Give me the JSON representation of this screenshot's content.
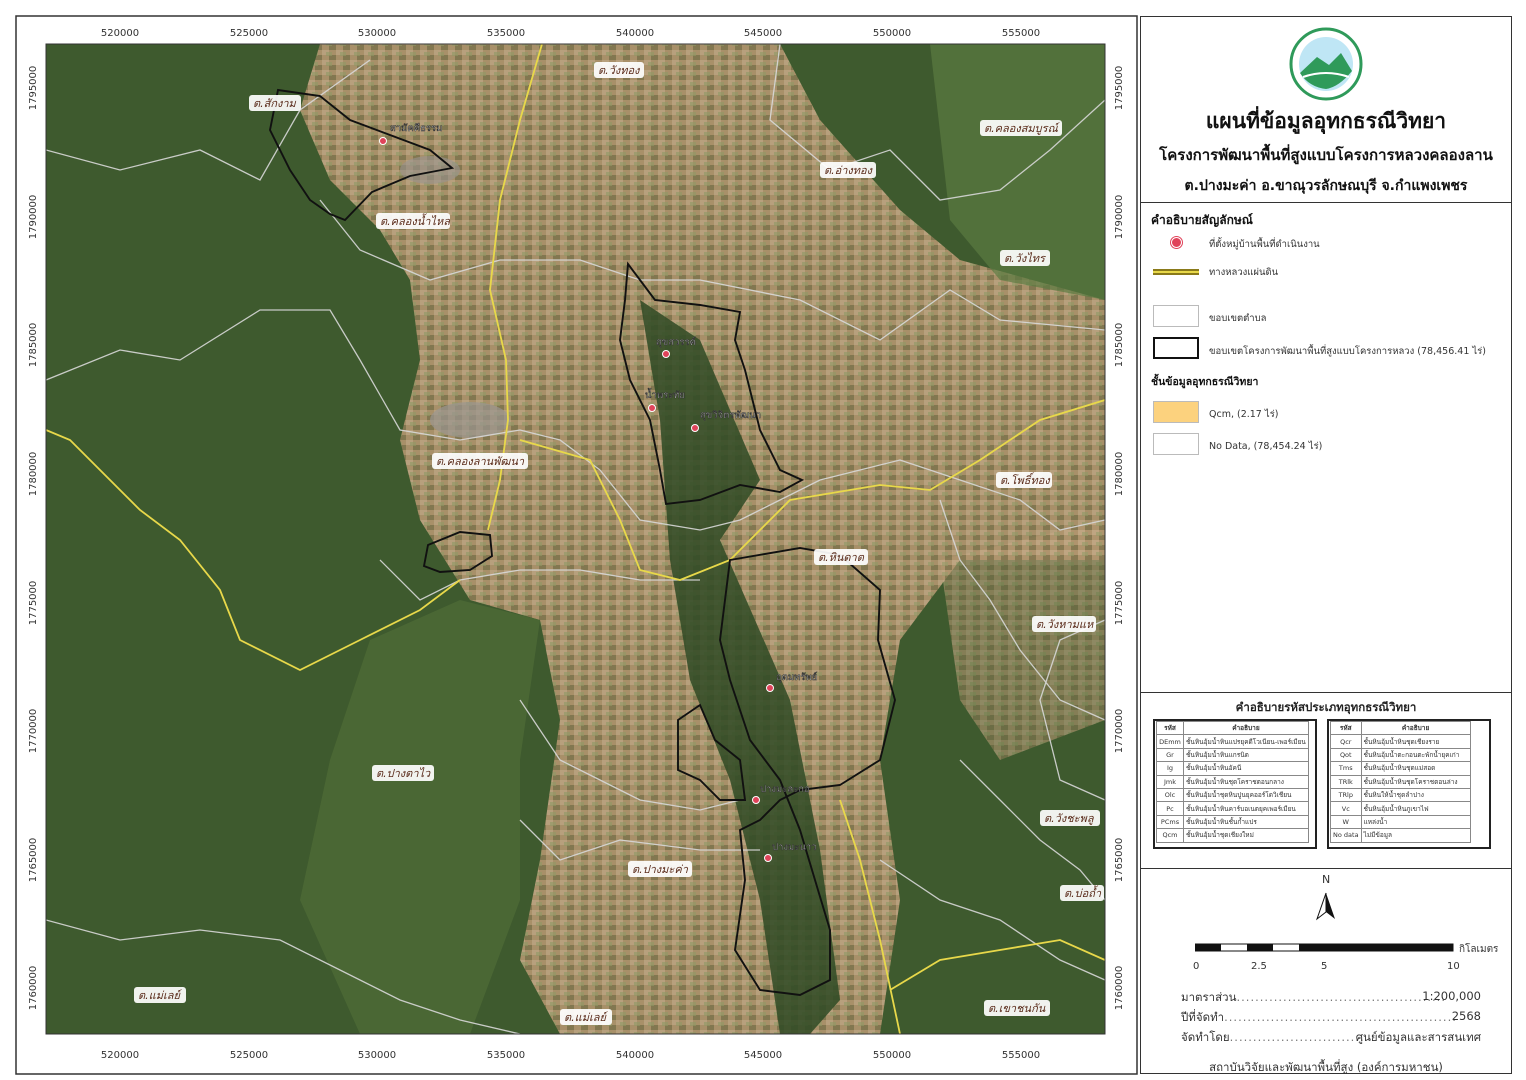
{
  "header": {
    "title": "แผนที่ข้อมูลอุทกธรณีวิทยา",
    "project": "โครงการพัฒนาพื้นที่สูงแบบโครงการหลวงคลองลาน",
    "location": "ต.ปางมะค่า อ.ขาณุวรลักษณบุรี จ.กำแพงเพชร"
  },
  "legend": {
    "heading": "คำอธิบายสัญลักษณ์",
    "village": "ที่ตั้งหมู่บ้านพื้นที่ดำเนินงาน",
    "highway": "ทางหลวงแผ่นดิน",
    "subdistrict": "ขอบเขตตำบล",
    "project_boundary": "ขอบเขตโครงการพัฒนาพื้นที่สูงแบบโครงการหลวง (78,456.41 ไร่)",
    "layer_heading": "ชั้นข้อมูลอุทกธรณีวิทยา",
    "qcm": "Qcm, (2.17 ไร่)",
    "nodata": "No Data, (78,454.24 ไร่)",
    "colors": {
      "qcm": "#fcd27e",
      "village": "#e0435a",
      "highway": "#e8d84a"
    }
  },
  "codes": {
    "heading": "คำอธิบายรหัสประเภทอุทกธรณีวิทยา",
    "col_code": "รหัส",
    "col_desc": "คำอธิบาย",
    "left": [
      [
        "DEmm",
        "ชั้นหินอุ้มน้ำหินแปรยุคดีโวเนียน-เพอร์เมียน"
      ],
      [
        "Gr",
        "ชั้นหินอุ้มน้ำหินแกรนิต"
      ],
      [
        "Ig",
        "ชั้นหินอุ้มน้ำหินอัคนี"
      ],
      [
        "Jmk",
        "ชั้นหินอุ้มน้ำหินชุดโคราชตอนกลาง"
      ],
      [
        "Olc",
        "ชั้นหินอุ้มน้ำชุดหินปูนยุคออร์โดวิเชียน"
      ],
      [
        "Pc",
        "ชั้นหินอุ้มน้ำหินคาร์บอเนตยุคเพอร์เมียน"
      ],
      [
        "PCms",
        "ชั้นหินอุ้มน้ำหินชั้นก้ำแปร"
      ],
      [
        "Qcm",
        "ชั้นหินอุ้มน้ำชุดเชียงใหม่"
      ]
    ],
    "right": [
      [
        "Qcr",
        "ชั้นหินอุ้มน้ำหินชุดเชียงราย"
      ],
      [
        "Qot",
        "ชั้นหินอุ้มน้ำตะกอนตะพักน้ำยุคเก่า"
      ],
      [
        "Tms",
        "ชั้นหินอุ้มน้ำหินชุดแม่สอด"
      ],
      [
        "TRlk",
        "ชั้นหินอุ้มน้ำหินชุดโคราชตอนล่าง"
      ],
      [
        "TRlp",
        "ชั้นหินให้น้ำชุดลำปาง"
      ],
      [
        "Vc",
        "ชั้นหินอุ้มน้ำหินภูเขาไฟ"
      ],
      [
        "W",
        "แหล่งน้ำ"
      ],
      [
        "No data",
        "ไม่มีข้อมูล"
      ]
    ]
  },
  "scale": {
    "north": "N",
    "unit": "กิโลเมตร",
    "ticks": [
      "0",
      "2.5",
      "5",
      "10"
    ]
  },
  "info": {
    "scale_label": "มาตราส่วน",
    "scale_value": "1:200,000",
    "year_label": "ปีที่จัดทำ",
    "year_value": "2568",
    "by_label": "จัดทำโดย",
    "by_value": "ศูนย์ข้อมูลและสารสนเทศ"
  },
  "footer": "สถาบันวิจัยและพัฒนาพื้นที่สูง (องค์การมหาชน)",
  "map": {
    "x_ticks": [
      "520000",
      "525000",
      "530000",
      "535000",
      "540000",
      "545000",
      "550000",
      "555000"
    ],
    "y_ticks": [
      "1795000",
      "1790000",
      "1785000",
      "1780000",
      "1775000",
      "1770000",
      "1765000",
      "1760000"
    ],
    "subdistricts": [
      "ต.สักงาม",
      "ต.คลองน้ำไหล",
      "ต.วังทอง",
      "ต.คลองสมบูรณ์",
      "ต.อ่างทอง",
      "ต.วังไทร",
      "ต.คลองลานพัฒนา",
      "ต.โพธิ์ทอง",
      "ต.หินดาต",
      "ต.วังหามแห",
      "ต.ปางตาไว",
      "ต.วังชะพลู",
      "ต.ปางมะค่า",
      "ต.บ่อถ้ำ",
      "ต.แม่เลย์",
      "ต.แม่เลย์",
      "ต.เขาชนกัน"
    ],
    "villages": [
      "สามัคคีธรรม",
      "สุขสวรรค์",
      "น้ำพระทัย",
      "สุขวิจิตรพัฒนา",
      "อุดมทรัพย์",
      "ปางมะละกอ",
      "ปางมะนาว"
    ]
  }
}
